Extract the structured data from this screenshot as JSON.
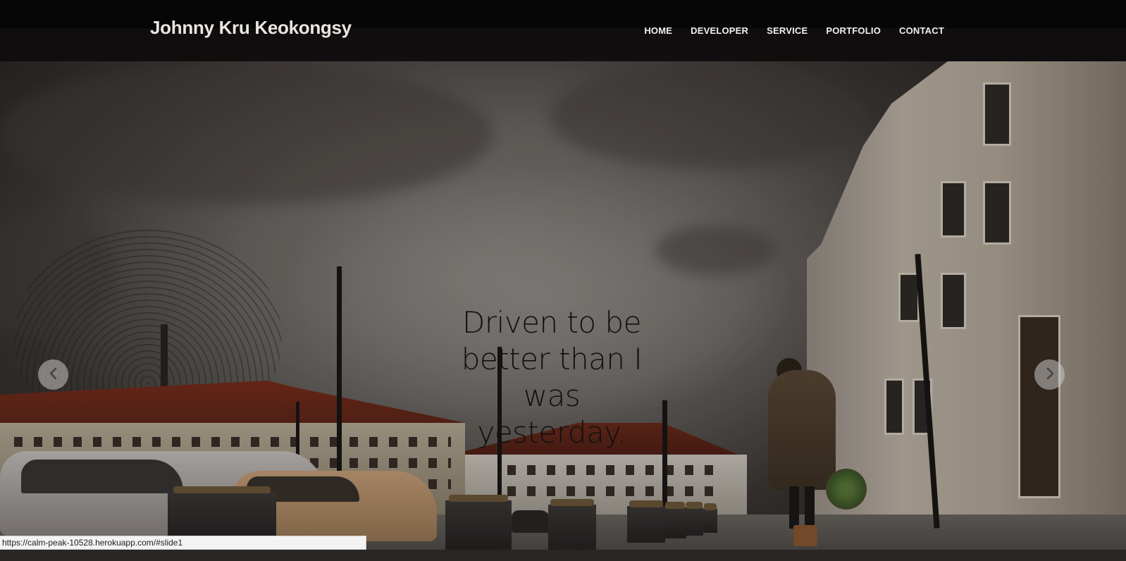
{
  "navbar": {
    "brand": "Johnny Kru Keokongsy",
    "links": [
      {
        "label": "HOME"
      },
      {
        "label": "DEVELOPER"
      },
      {
        "label": "SERVICE"
      },
      {
        "label": "PORTFOLIO"
      },
      {
        "label": "CONTACT"
      }
    ]
  },
  "hero": {
    "caption": "Driven to be better than I was yesterday."
  },
  "carousel": {
    "prev_icon": "chevron-left-icon",
    "next_icon": "chevron-right-icon"
  },
  "status_bar": {
    "url": "https://calm-peak-10528.herokuapp.com/#slide1"
  },
  "colors": {
    "navbar_bg": "#060606",
    "nav_text": "#f2f0ee",
    "caption_text": "#111111",
    "control_bg": "#c8c6c4"
  }
}
